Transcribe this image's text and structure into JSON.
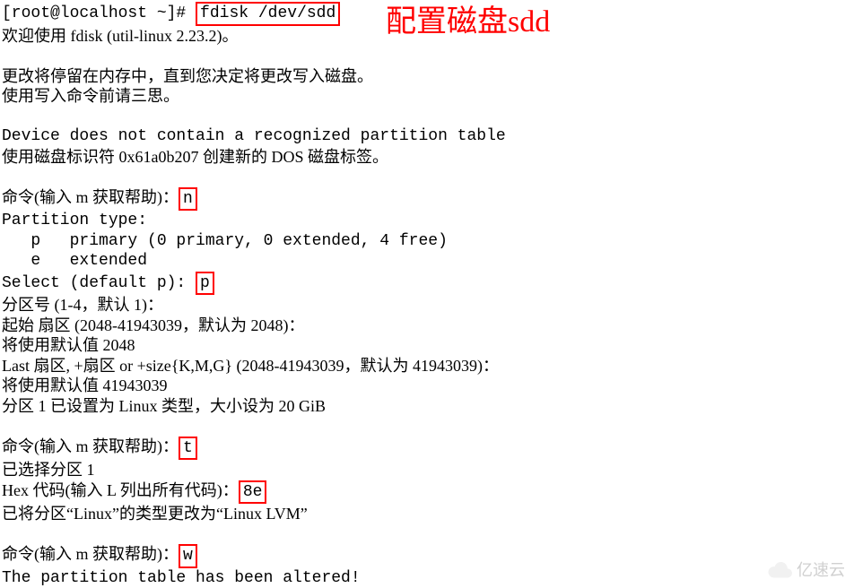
{
  "annotation": {
    "title": "配置磁盘sdd"
  },
  "prompt": {
    "prefix": "[root@localhost ~]# ",
    "command": "fdisk /dev/sdd"
  },
  "welcome": "欢迎使用 fdisk (util-linux 2.23.2)。",
  "memnote1": "更改将停留在内存中，直到您决定将更改写入磁盘。",
  "memnote2": "使用写入命令前请三思。",
  "device_line": "Device does not contain a recognized partition table",
  "doslabel": "使用磁盘标识符 0x61a0b207 创建新的 DOS 磁盘标签。",
  "cmd_prompt": "命令(输入 m 获取帮助)：",
  "input_n": "n",
  "ptype_header": "Partition type:",
  "ptype_p": "   p   primary (0 primary, 0 extended, 4 free)",
  "ptype_e": "   e   extended",
  "select_prefix": "Select (default p): ",
  "input_p": "p",
  "partnum": "分区号 (1-4，默认 1)：",
  "firstsector": "起始 扇区 (2048-41943039，默认为 2048)：",
  "usedefault1": "将使用默认值 2048",
  "lastsector": "Last 扇区, +扇区 or +size{K,M,G} (2048-41943039，默认为 41943039)：",
  "usedefault2": "将使用默认值 41943039",
  "partset": "分区 1 已设置为 Linux 类型，大小设为 20 GiB",
  "input_t": "t",
  "selected": "已选择分区 1",
  "hex_prefix": "Hex 代码(输入 L 列出所有代码)：",
  "input_8e": "8e",
  "changed": "已将分区“Linux”的类型更改为“Linux LVM”",
  "input_w": "w",
  "altered": "The partition table has been altered!",
  "watermark": "亿速云"
}
